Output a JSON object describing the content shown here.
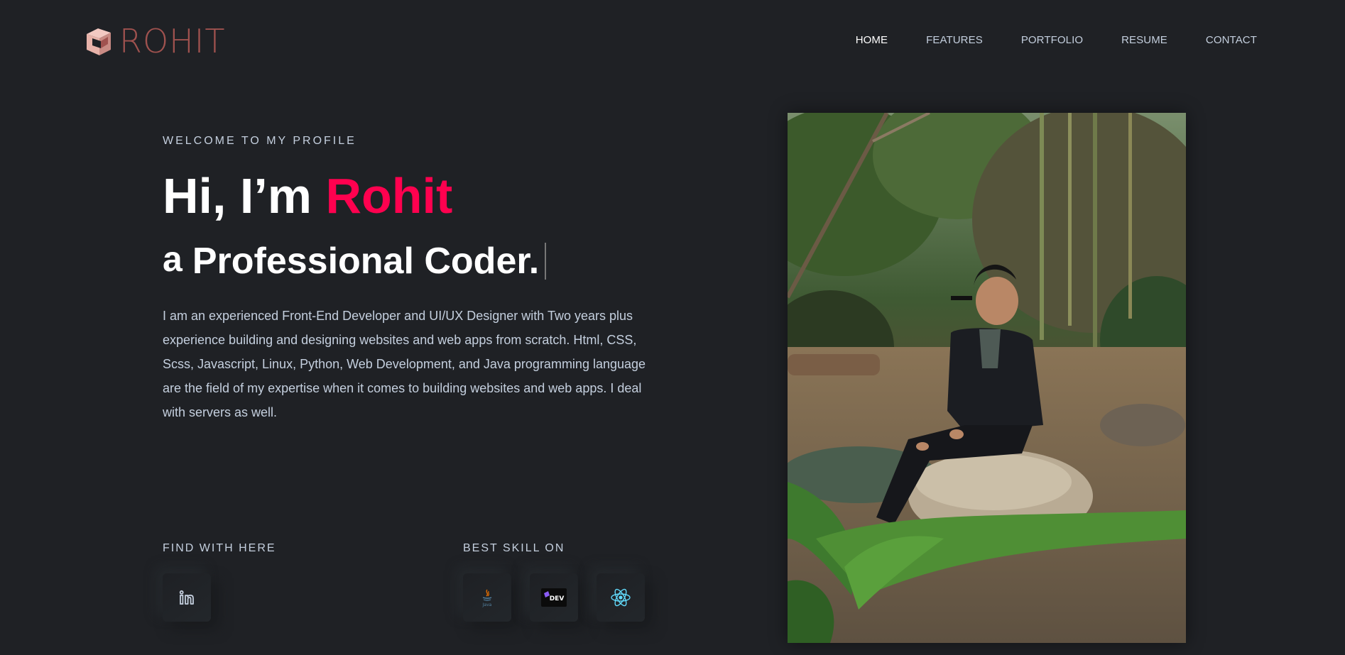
{
  "header": {
    "logo_text": "ROHIT",
    "nav": [
      {
        "label": "HOME",
        "active": true
      },
      {
        "label": "FEATURES",
        "active": false
      },
      {
        "label": "PORTFOLIO",
        "active": false
      },
      {
        "label": "RESUME",
        "active": false
      },
      {
        "label": "CONTACT",
        "active": false
      }
    ]
  },
  "hero": {
    "welcome": "WELCOME TO MY PROFILE",
    "greeting": "Hi, I’m ",
    "name": "Rohit",
    "sub_prefix": "a",
    "sub_role": "Professional Coder.",
    "bio": "I am an experienced Front-End Developer and UI/UX Designer with Two years plus experience building and designing websites and web apps from scratch. Html, CSS, Scss, Javascript, Linux, Python, Web Development, and Java programming language are the field of my expertise when it comes to building websites and web apps. I deal with servers as well."
  },
  "find": {
    "title": "FIND WITH HERE",
    "icons": [
      "linkedin-icon"
    ]
  },
  "skills": {
    "title": "BEST SKILL ON",
    "icons": [
      "java-icon",
      "dev-icon",
      "react-icon"
    ],
    "java_caption": "Java",
    "dev_badge": "DEV"
  },
  "colors": {
    "background": "#1f2125",
    "accent": "#ff014f",
    "text_muted": "#c4cfde",
    "logo": "#a0524f"
  }
}
